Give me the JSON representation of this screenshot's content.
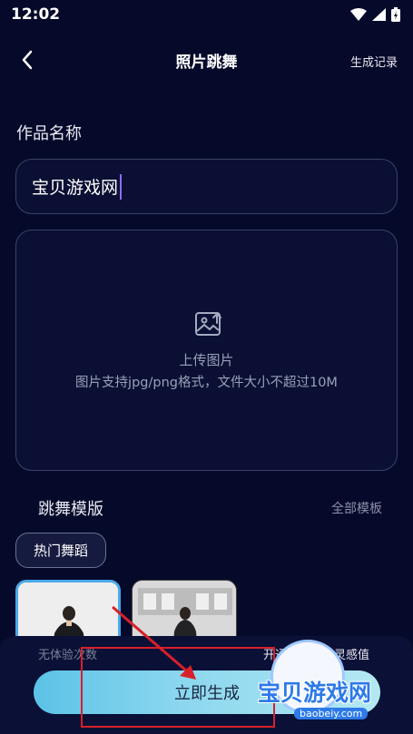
{
  "status_bar": {
    "time": "12:02"
  },
  "header": {
    "title": "照片跳舞",
    "history_label": "生成记录"
  },
  "form": {
    "name_label": "作品名称",
    "name_value": "宝贝游戏网",
    "upload_title": "上传图片",
    "upload_hint": "图片支持jpg/png格式，文件大小不超过10M"
  },
  "templates": {
    "title": "跳舞模版",
    "all_label": "全部模板",
    "category": "热门舞蹈"
  },
  "bottom": {
    "free_count": "无体验次数",
    "vip_label": "开通会员获取灵感值",
    "generate_label": "立即生成"
  },
  "watermark": {
    "text": "宝贝游戏网",
    "url": "baobeiy.com"
  },
  "colors": {
    "background": "#060a2a",
    "accent": "#5bc2e6",
    "annotation": "#d8202a"
  }
}
